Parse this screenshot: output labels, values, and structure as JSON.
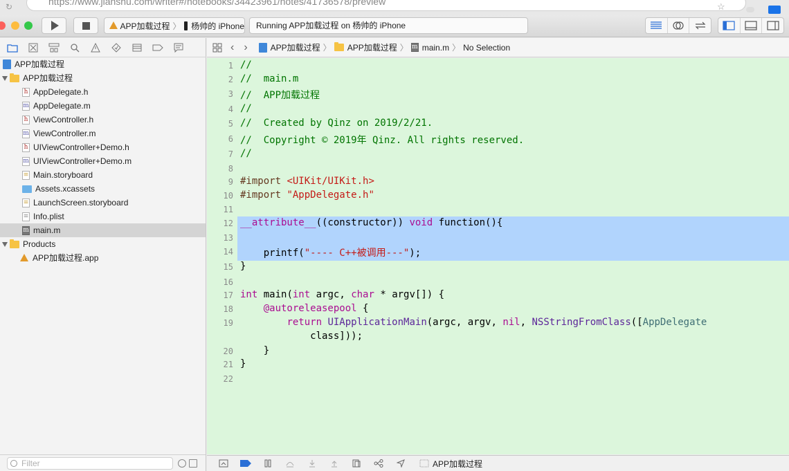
{
  "browser": {
    "url": "https://www.jianshu.com/writer#/notebooks/34423961/notes/41736578/preview"
  },
  "toolbar": {
    "scheme_target": "APP加载过程",
    "scheme_device": "杨帅的 iPhone",
    "activity_text": "Running APP加载过程 on 杨帅的 iPhone"
  },
  "navigator": {
    "project": "APP加载过程",
    "group": "APP加载过程",
    "files": [
      {
        "label": "AppDelegate.h",
        "icon": "h-file-icon"
      },
      {
        "label": "AppDelegate.m",
        "icon": "m-file-icon"
      },
      {
        "label": "ViewController.h",
        "icon": "h-file-icon"
      },
      {
        "label": "ViewController.m",
        "icon": "m-file-icon"
      },
      {
        "label": "UIViewController+Demo.h",
        "icon": "h-file-icon"
      },
      {
        "label": "UIViewController+Demo.m",
        "icon": "m-file-icon"
      },
      {
        "label": "Main.storyboard",
        "icon": "storyboard-icon"
      },
      {
        "label": "Assets.xcassets",
        "icon": "xcassets-icon"
      },
      {
        "label": "LaunchScreen.storyboard",
        "icon": "storyboard-icon"
      },
      {
        "label": "Info.plist",
        "icon": "plist-icon"
      },
      {
        "label": "main.m",
        "icon": "m-file-icon",
        "selected": true
      }
    ],
    "products_group": "Products",
    "product": "APP加载过程.app",
    "filter_placeholder": "Filter"
  },
  "jumpbar": {
    "crumbs": [
      "APP加载过程",
      "APP加载过程",
      "main.m",
      "No Selection"
    ]
  },
  "editor": {
    "line_numbers": [
      "1",
      "2",
      "3",
      "4",
      "5",
      "6",
      "7",
      "8",
      "9",
      "10",
      "11",
      "12",
      "13",
      "14",
      "15",
      "16",
      "17",
      "18",
      "19",
      "",
      "20",
      "21",
      "22"
    ],
    "lines": [
      "//",
      "//  main.m",
      "//  APP加载过程",
      "//",
      "//  Created by Qinz on 2019/2/21.",
      "//  Copyright © 2019年 Qinz. All rights reserved.",
      "//",
      "",
      "#import <UIKit/UIKit.h>",
      "#import \"AppDelegate.h\"",
      "",
      "__attribute__((constructor)) void function(){",
      "",
      "    printf(\"---- C++被调用---\");",
      "}",
      "",
      "int main(int argc, char * argv[]) {",
      "    @autoreleasepool {",
      "        return UIApplicationMain(argc, argv, nil, NSStringFromClass([AppDelegate",
      "            class]));",
      "    }",
      "}",
      ""
    ],
    "selected_lines": [
      "12",
      "13",
      "14",
      "15"
    ]
  },
  "debugbar": {
    "target": "APP加载过程"
  },
  "colors": {
    "editor_bg": "#dcf6dc",
    "selection": "#b1d4fd",
    "comment": "#007400",
    "keyword": "#aa0d91",
    "string": "#c41a16",
    "accent": "#1a73e8"
  }
}
